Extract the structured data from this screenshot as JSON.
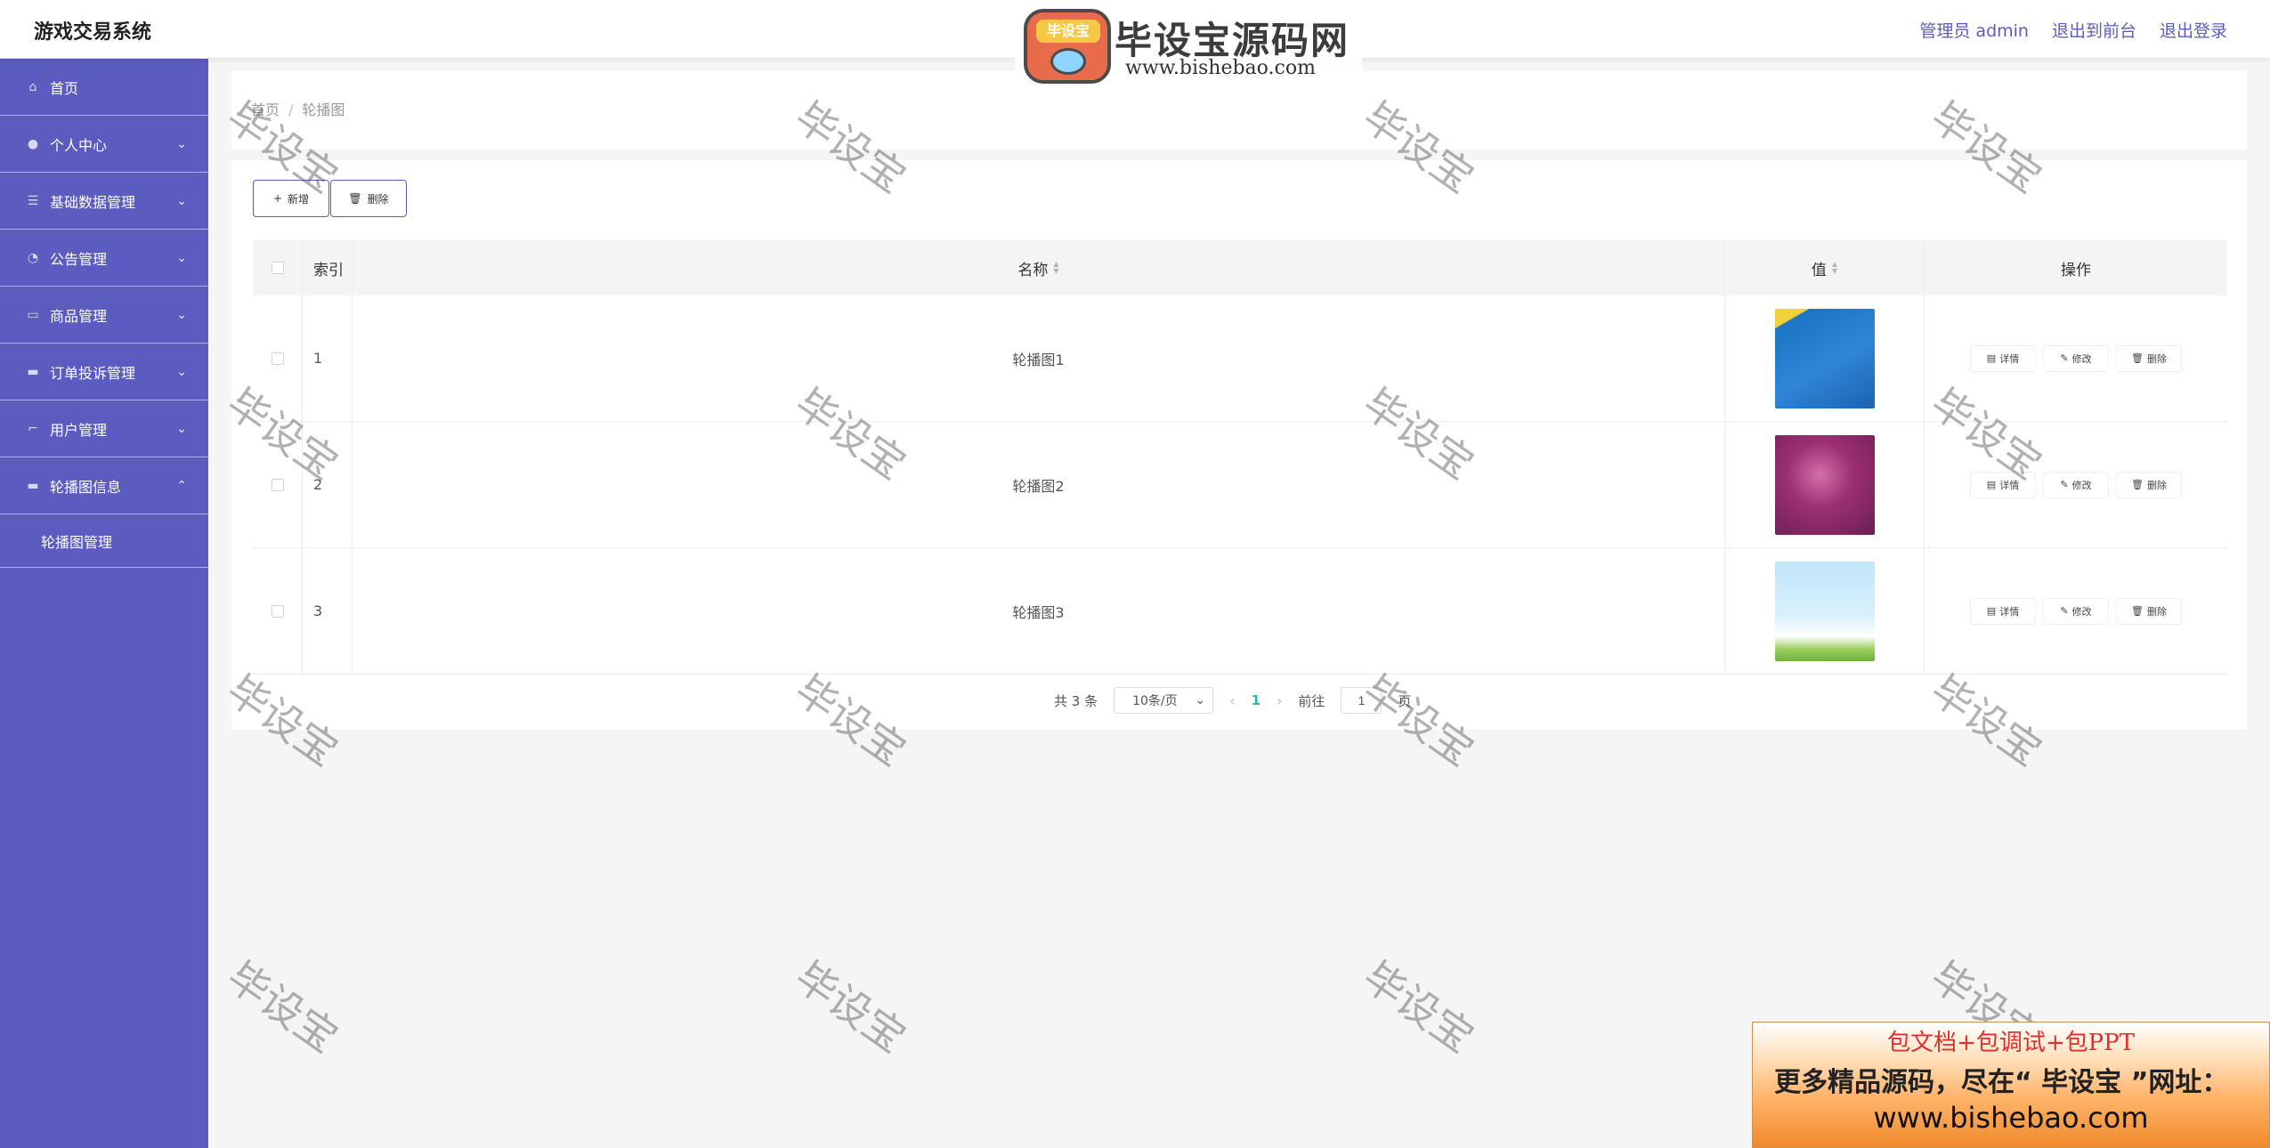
{
  "app": {
    "title": "游戏交易系统"
  },
  "header_links": [
    "管理员 admin",
    "退出到前台",
    "退出登录"
  ],
  "logo": {
    "badge": "毕设宝",
    "cn": "毕设宝源码网",
    "en": "www.bishebao.com"
  },
  "sidebar": {
    "items": [
      {
        "label": "首页",
        "icon": "home-icon",
        "glyph": "⌂",
        "expandable": false
      },
      {
        "label": "个人中心",
        "icon": "user-icon",
        "glyph": "●",
        "expandable": true
      },
      {
        "label": "基础数据管理",
        "icon": "list-icon",
        "glyph": "☰",
        "expandable": true
      },
      {
        "label": "公告管理",
        "icon": "dashboard-icon",
        "glyph": "◔",
        "expandable": true
      },
      {
        "label": "商品管理",
        "icon": "message-icon",
        "glyph": "▭",
        "expandable": true
      },
      {
        "label": "订单投诉管理",
        "icon": "monitor-icon",
        "glyph": "▬",
        "expandable": true
      },
      {
        "label": "用户管理",
        "icon": "crop-icon",
        "glyph": "⌐",
        "expandable": true
      },
      {
        "label": "轮播图信息",
        "icon": "desktop-icon",
        "glyph": "▬",
        "expandable": true,
        "expanded": true
      }
    ],
    "submenu": [
      "轮播图管理"
    ]
  },
  "breadcrumb": {
    "home": "首页",
    "sep": "/",
    "current": "轮播图"
  },
  "toolbar": {
    "add_label": "新增",
    "add_glyph": "+",
    "delete_label": "删除",
    "delete_glyph": "🗑"
  },
  "table": {
    "columns": [
      "索引",
      "名称",
      "值",
      "操作"
    ],
    "rows": [
      {
        "index": "1",
        "name": "轮播图1"
      },
      {
        "index": "2",
        "name": "轮播图2"
      },
      {
        "index": "3",
        "name": "轮播图3"
      }
    ],
    "row_actions": {
      "detail": "详情",
      "edit": "修改",
      "delete": "删除",
      "detail_glyph": "▤",
      "edit_glyph": "✎",
      "delete_glyph": "🗑"
    }
  },
  "pagination": {
    "total_text": "共 3 条",
    "page_size": "10条/页",
    "prev": "‹",
    "current_page": "1",
    "next": "›",
    "goto_prefix": "前往",
    "goto_value": "1",
    "goto_suffix": "页"
  },
  "watermark": {
    "text": "毕设宝"
  },
  "ad": {
    "line1": "包文档+包调试+包PPT",
    "line2": "更多精品源码，尽在“ 毕设宝 ”网址：",
    "line3": "www.bishebao.com"
  },
  "colors": {
    "sidebar": "#5b5bc0",
    "accent": "#5b5bc0",
    "page_active": "#2ab8a4"
  }
}
